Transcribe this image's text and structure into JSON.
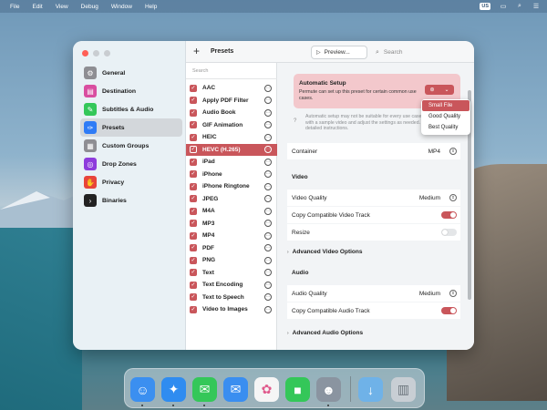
{
  "menubar": {
    "items": [
      "File",
      "Edit",
      "View",
      "Debug",
      "Window",
      "Help"
    ],
    "input_source": "US"
  },
  "toolbar": {
    "add_label": "+",
    "title": "Presets",
    "preview_label": "Preview...",
    "search_placeholder": "Search"
  },
  "sidebar": {
    "items": [
      {
        "label": "General",
        "icon": "gear-icon",
        "color": "#8e8e93"
      },
      {
        "label": "Destination",
        "icon": "folder-icon",
        "color": "#d94ea0"
      },
      {
        "label": "Subtitles & Audio",
        "icon": "speech-bubble-icon",
        "color": "#34c759"
      },
      {
        "label": "Presets",
        "icon": "wrench-icon",
        "color": "#2f7cf6"
      },
      {
        "label": "Custom Groups",
        "icon": "stack-icon",
        "color": "#8e8e93"
      },
      {
        "label": "Drop Zones",
        "icon": "drop-zone-icon",
        "color": "#8e3cdc"
      },
      {
        "label": "Privacy",
        "icon": "hand-icon",
        "color": "#e8443a"
      },
      {
        "label": "Binaries",
        "icon": "terminal-icon",
        "color": "#222222"
      }
    ],
    "active_index": 3
  },
  "preset_list": {
    "search_placeholder": "Search",
    "items": [
      "AAC",
      "Apply PDF Filter",
      "Audio Book",
      "GIF Animation",
      "HEIC",
      "HEVC (H.265)",
      "iPad",
      "iPhone",
      "iPhone Ringtone",
      "JPEG",
      "M4A",
      "MP3",
      "MP4",
      "PDF",
      "PNG",
      "Text",
      "Text Encoding",
      "Text to Speech",
      "Video to Images"
    ],
    "selected_index": 5
  },
  "detail": {
    "automatic_setup": {
      "title": "Automatic Setup",
      "description": "Permute can set up this preset for certain common use cases.",
      "note": "Automatic setup may not be suitable for every use case. Try the preset with a sample video and adjust the settings as needed. See the Help for detailed instructions.",
      "help": "?"
    },
    "container": {
      "label": "Container",
      "value": "MP4"
    },
    "video_section": "Video",
    "video_quality": {
      "label": "Video Quality",
      "value": "Medium"
    },
    "copy_video": {
      "label": "Copy Compatible Video Track",
      "on": true
    },
    "resize": {
      "label": "Resize",
      "on": false
    },
    "advanced_video": "Advanced Video Options",
    "audio_section": "Audio",
    "audio_quality": {
      "label": "Audio Quality",
      "value": "Medium"
    },
    "copy_audio": {
      "label": "Copy Compatible Audio Track",
      "on": true
    },
    "advanced_audio": "Advanced Audio Options"
  },
  "dropdown": {
    "options": [
      "Small File",
      "Good Quality",
      "Best Quality"
    ],
    "selected_index": 0
  },
  "dock": {
    "apps": [
      {
        "name": "finder-icon",
        "color": "#3b8ff0",
        "glyph": "☺"
      },
      {
        "name": "safari-icon",
        "color": "#2f8cf0",
        "glyph": "✦"
      },
      {
        "name": "messages-icon",
        "color": "#34c759",
        "glyph": "✉"
      },
      {
        "name": "mail-icon",
        "color": "#3a8ef0",
        "glyph": "✉"
      },
      {
        "name": "photos-icon",
        "color": "#f5f5f5",
        "glyph": "✿"
      },
      {
        "name": "facetime-icon",
        "color": "#34c759",
        "glyph": "■"
      },
      {
        "name": "permute-icon",
        "color": "#8a94a0",
        "glyph": "☻"
      },
      {
        "name": "downloads-folder-icon",
        "color": "#6fb2e8",
        "glyph": "↓"
      },
      {
        "name": "trash-icon",
        "color": "#c8ced4",
        "glyph": "▥"
      }
    ],
    "accent": "#c9565b"
  }
}
